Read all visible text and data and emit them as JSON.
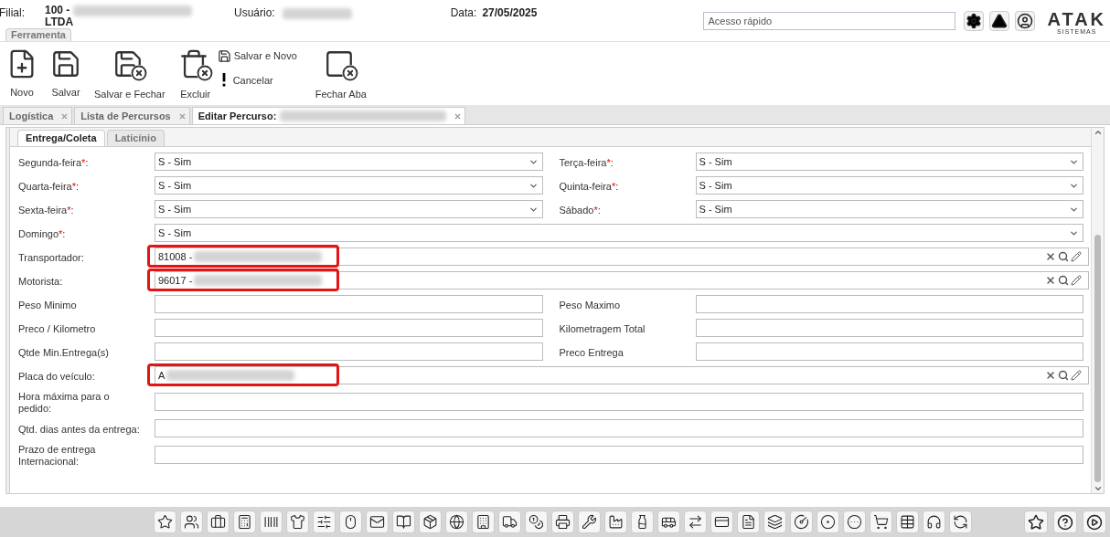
{
  "header": {
    "filial_label": "Filial:",
    "filial_code": "100 -",
    "filial_suffix": "LTDA",
    "user_label": "Usuário:",
    "date_label": "Data:",
    "date": "27/05/2025",
    "quick_access": {
      "placeholder": "Acesso rápido"
    },
    "logo": "ATAK",
    "logo_sub": "SISTEMAS"
  },
  "ribbon_tab": {
    "label": "Ferramenta",
    "selected": true
  },
  "toolbar": [
    {
      "kind": "big",
      "label": "Novo"
    },
    {
      "kind": "big",
      "label": "Salvar"
    },
    {
      "kind": "big",
      "label": "Salvar e Fechar"
    },
    {
      "kind": "big",
      "label": "Excluir"
    },
    {
      "kind": "small_stack",
      "items": [
        {
          "label": "Salvar e Novo"
        },
        {
          "label": "Cancelar"
        }
      ]
    },
    {
      "kind": "big",
      "label": "Fechar Aba"
    }
  ],
  "doc_tabs": [
    {
      "label": "Logística",
      "selected": false,
      "blurred": false
    },
    {
      "label": "Lista de Percursos",
      "selected": false,
      "blurred": false
    },
    {
      "label": "Editar Percurso:",
      "selected": true,
      "blurred": true
    }
  ],
  "form_tabs": [
    {
      "label": "Entrega/Coleta",
      "selected": true
    },
    {
      "label": "Laticínio",
      "selected": false
    }
  ],
  "rows": [
    {
      "fields": [
        {
          "label": "Segunda-feira",
          "required": "*",
          "colon": ":",
          "kind": "select",
          "value": "S - Sim"
        },
        {
          "label": "Terça-feira",
          "required": "*",
          "colon": ":",
          "kind": "select",
          "value": "S - Sim"
        }
      ]
    },
    {
      "fields": [
        {
          "label": "Quarta-feira",
          "required": "*",
          "colon": ":",
          "kind": "select",
          "value": "S - Sim"
        },
        {
          "label": "Quinta-feira",
          "required": "*",
          "colon": ":",
          "kind": "select",
          "value": "S - Sim"
        }
      ]
    },
    {
      "fields": [
        {
          "label": "Sexta-feira",
          "required": "*",
          "colon": ":",
          "kind": "select",
          "value": "S - Sim"
        },
        {
          "label": "Sábado",
          "required": "*",
          "colon": ":",
          "kind": "select",
          "value": "S - Sim"
        }
      ]
    },
    {
      "fields": [
        {
          "label": "Domingo",
          "required": "*",
          "colon": ":",
          "kind": "select",
          "value": "S - Sim"
        }
      ]
    },
    {
      "fields": [
        {
          "label": "Transportador:",
          "kind": "lookup",
          "value": "81008 -",
          "blurred": true,
          "highlighted": true
        }
      ]
    },
    {
      "fields": [
        {
          "label": "Motorista:",
          "kind": "lookup",
          "value": "96017 -",
          "blurred": true,
          "highlighted": true
        }
      ]
    },
    {
      "fields": [
        {
          "label": "Peso Minimo",
          "kind": "text"
        },
        {
          "label": "Peso Maximo",
          "kind": "text"
        }
      ]
    },
    {
      "fields": [
        {
          "label": "Preco / Kilometro",
          "kind": "text"
        },
        {
          "label": "Kilometragem Total",
          "kind": "text"
        }
      ]
    },
    {
      "fields": [
        {
          "label": "Qtde Min.Entrega(s)",
          "kind": "text"
        },
        {
          "label": "Preco Entrega",
          "kind": "text"
        }
      ]
    },
    {
      "fields": [
        {
          "label": "Placa do veículo:",
          "kind": "lookup",
          "value": "A",
          "blurred": true,
          "highlighted": true
        }
      ]
    },
    {
      "fields": [
        {
          "label": "Hora máxima para o pedido:",
          "kind": "text"
        }
      ]
    },
    {
      "fields": [
        {
          "label": "Qtd. dias antes da entrega:",
          "kind": "text"
        }
      ]
    },
    {
      "fields": [
        {
          "label": "Prazo de entrega Internacional:",
          "kind": "text"
        }
      ]
    }
  ]
}
